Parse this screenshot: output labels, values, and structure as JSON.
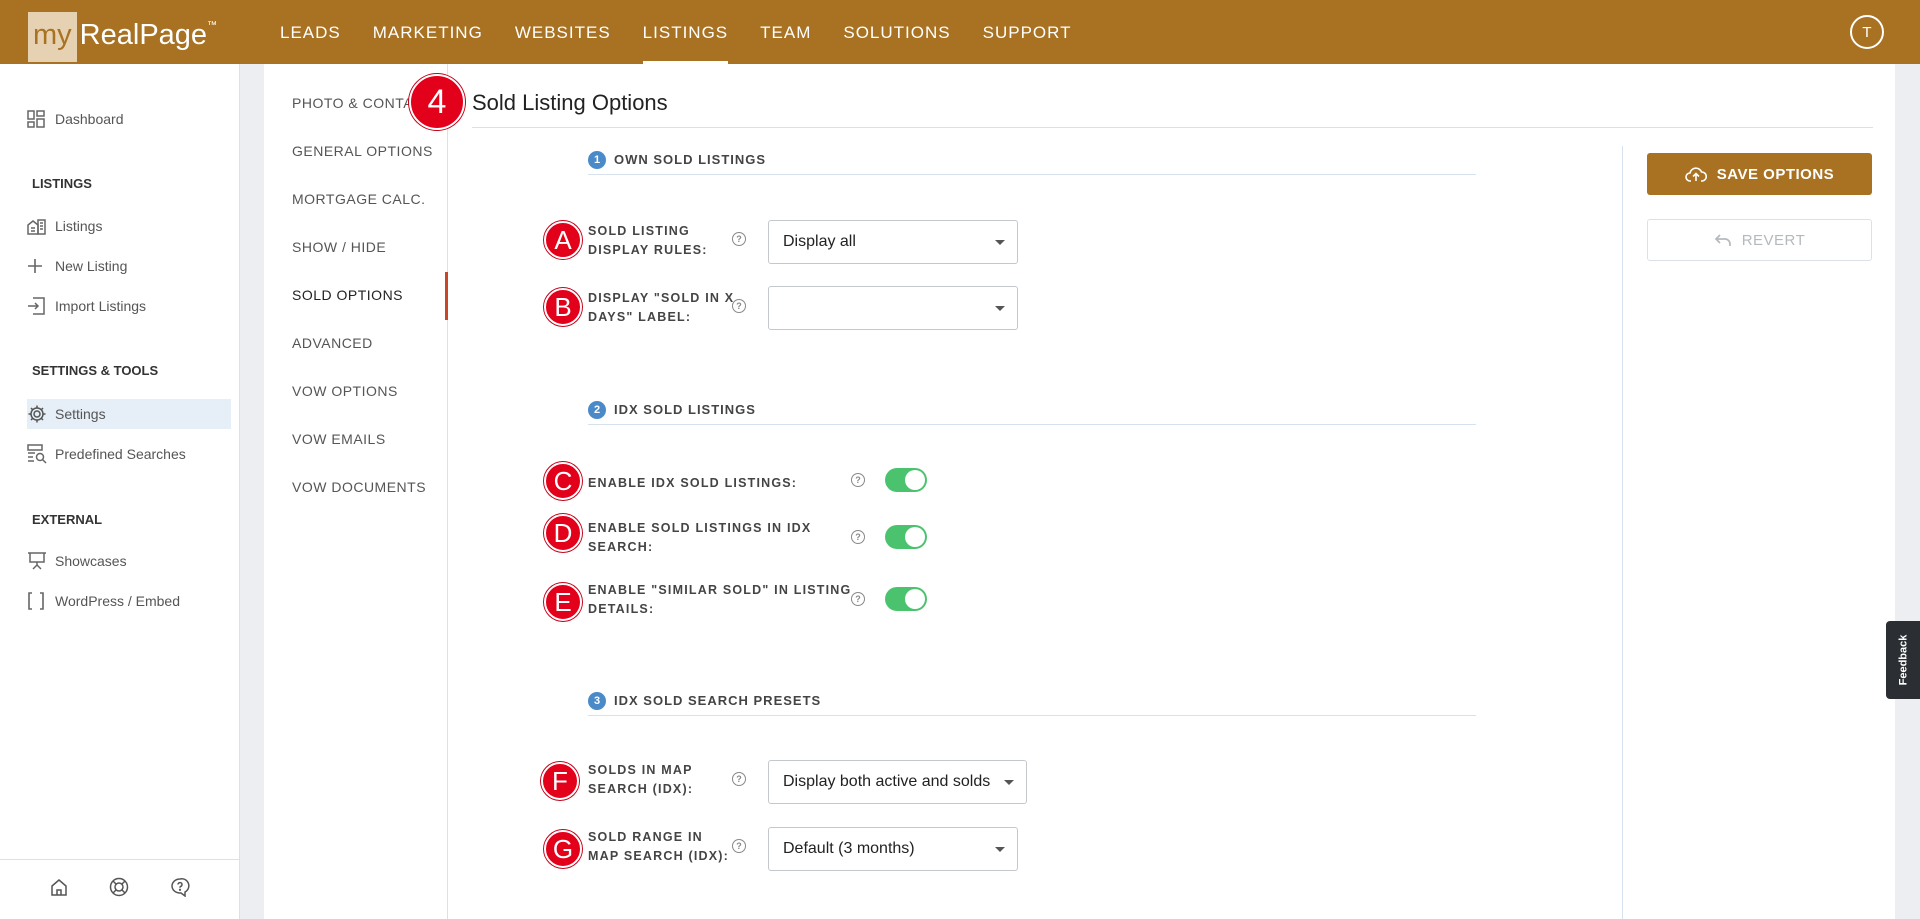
{
  "app": {
    "logo_my": "my",
    "logo_name": "RealPage",
    "logo_tm": "™"
  },
  "topnav": [
    "LEADS",
    "MARKETING",
    "WEBSITES",
    "LISTINGS",
    "TEAM",
    "SOLUTIONS",
    "SUPPORT"
  ],
  "user": {
    "initial": "T"
  },
  "sidebar": {
    "dashboard": "Dashboard",
    "listings_head": "LISTINGS",
    "listings": "Listings",
    "new_listing": "New Listing",
    "import_listings": "Import Listings",
    "settings_head": "SETTINGS & TOOLS",
    "settings": "Settings",
    "predefined_searches": "Predefined Searches",
    "external_head": "EXTERNAL",
    "showcases": "Showcases",
    "wordpress": "WordPress / Embed"
  },
  "subnav": [
    "PHOTO & CONTACT",
    "GENERAL OPTIONS",
    "MORTGAGE CALC.",
    "SHOW / HIDE",
    "SOLD OPTIONS",
    "ADVANCED",
    "VOW OPTIONS",
    "VOW EMAILS",
    "VOW DOCUMENTS"
  ],
  "page": {
    "title": "Sold Listing Options",
    "marker": "4"
  },
  "sections": {
    "own": {
      "num": "1",
      "title": "OWN SOLD LISTINGS"
    },
    "idx": {
      "num": "2",
      "title": "IDX SOLD LISTINGS"
    },
    "presets": {
      "num": "3",
      "title": "IDX SOLD SEARCH PRESETS"
    }
  },
  "fields": {
    "a": {
      "marker": "A",
      "label1": "SOLD LISTING",
      "label2": "DISPLAY RULES:",
      "value": "Display all"
    },
    "b": {
      "marker": "B",
      "label1": "DISPLAY \"SOLD IN X",
      "label2": "DAYS\" LABEL:",
      "value": ""
    },
    "c": {
      "marker": "C",
      "label1": "ENABLE IDX SOLD LISTINGS:",
      "enabled": true
    },
    "d": {
      "marker": "D",
      "label1": "ENABLE SOLD LISTINGS IN IDX",
      "label2": "SEARCH:",
      "enabled": true
    },
    "e": {
      "marker": "E",
      "label1": "ENABLE \"SIMILAR SOLD\" IN LISTING",
      "label2": "DETAILS:",
      "enabled": true
    },
    "f": {
      "marker": "F",
      "label1": "SOLDS IN MAP",
      "label2": "SEARCH (IDX):",
      "value": "Display both active and solds"
    },
    "g": {
      "marker": "G",
      "label1": "SOLD RANGE IN",
      "label2": "MAP SEARCH (IDX):",
      "value": "Default (3 months)"
    }
  },
  "help_glyph": "?",
  "actions": {
    "save": "SAVE OPTIONS",
    "revert": "REVERT"
  },
  "feedback": "Feedback",
  "colors": {
    "brand": "#a87222",
    "toggle_on": "#4bc36e",
    "marker": "#e3001b",
    "section_badge": "#4b8ac9"
  }
}
